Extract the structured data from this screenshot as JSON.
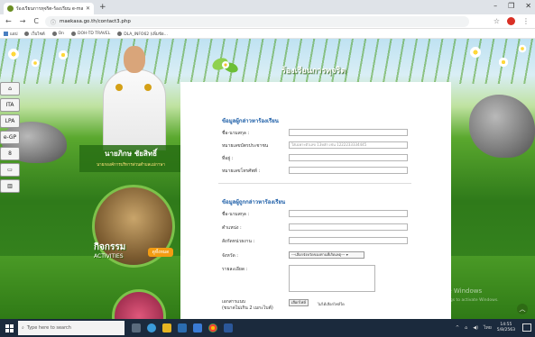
{
  "browser": {
    "tab_title": "ร้องเรียนการทุจริต-ร้องเรียน e-mail",
    "new_tab": "+",
    "window_controls": [
      "–",
      "❐",
      "✕"
    ],
    "nav": [
      "←",
      "→",
      "C"
    ],
    "url": "maekasa.go.th/contact3.php",
    "bookmarks": [
      "แอป",
      "เว็บไซต์",
      "On",
      "DOH-TD TRAVEL",
      "DLA_INFO62 (เพิ่มข้อ..."
    ]
  },
  "sidebar": {
    "items": [
      "⌂",
      "ITA",
      "LPA",
      "e-GP",
      "8",
      "▭",
      "▥"
    ]
  },
  "profile": {
    "name": "นายภิกษ ชัยสิทธิ์",
    "position": "นายกองค์การบริหารส่วนตำบลแม่กาษา"
  },
  "activities": {
    "title": "กิจกรรม",
    "subtitle": "ACTIVITIES",
    "button": "ดูทั้งหมด"
  },
  "banner": {
    "title": "ร้องเรียนการทุจริต"
  },
  "form": {
    "section1_title": "ข้อมูลผู้กล่าวหาร้องเรียน",
    "section1_fields": [
      {
        "label": "ชื่อ-นามสกุล :",
        "placeholder": ""
      },
      {
        "label": "หมายเลขบัตรประชาชน",
        "placeholder": "ใส่เฉพาะตัวเลข 13หลัก เช่น 1222233334445"
      },
      {
        "label": "ที่อยู่ :",
        "placeholder": ""
      },
      {
        "label": "หมายเลขโทรศัพท์ :",
        "placeholder": ""
      }
    ],
    "section2_title": "ข้อมูลผู้ถูกกล่าวหาร้องเรียน",
    "section2_fields": [
      {
        "label": "ชื่อ-นามสกุล :",
        "placeholder": ""
      },
      {
        "label": "ตำแหน่ง :",
        "placeholder": ""
      },
      {
        "label": "สังกัดหน่วยงาน :",
        "placeholder": ""
      }
    ],
    "province_label": "จังหวัด :",
    "province_selected": "---เลือกจังหวัดของท่านที่เกิดเหตุ---",
    "detail_label": "รายละเอียด :",
    "attach_label_line1": "เอกสารแนบ",
    "attach_label_line2": "(ขนาดไม่เกิน 2 เมกะไบต์)",
    "file_button": "เลือกไฟล์",
    "file_status": "ไม่ได้เลือกไฟล์ใด"
  },
  "watermark": {
    "line1": "Activate Windows",
    "line2": "Go to Settings to activate Windows."
  },
  "taskbar": {
    "search_placeholder": "Type here to search",
    "language": "ไทย",
    "time": "14:55",
    "date": "5/8/2563"
  }
}
